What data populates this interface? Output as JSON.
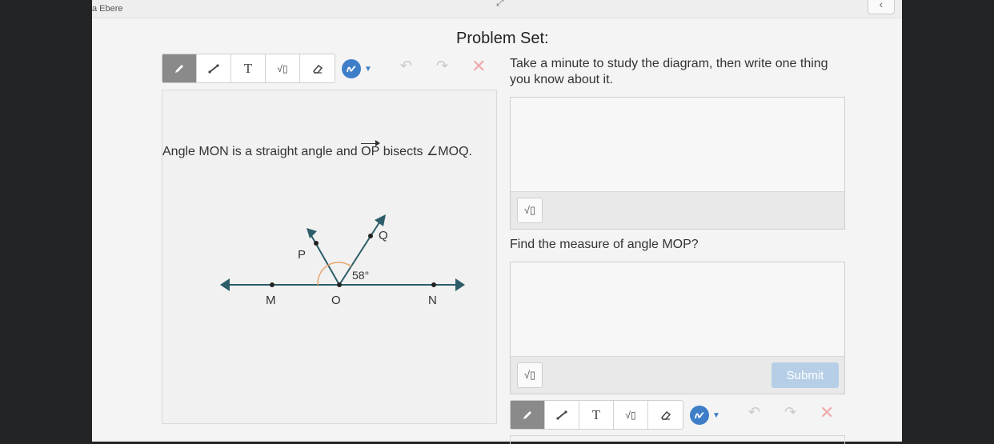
{
  "user": {
    "name": "a Ebere"
  },
  "header": {
    "title": "Problem Set:"
  },
  "toolbar": {
    "pencil": "pencil-icon",
    "line": "line-icon",
    "text_label": "T",
    "sqrt_label": "√▯",
    "eraser": "eraser-icon",
    "undo": "↶",
    "redo": "↷",
    "clear": "✕"
  },
  "problem": {
    "statement_pre": "Angle MON is a straight angle and ",
    "ray_label": "OP",
    "statement_post": " bisects ∠MOQ.",
    "diagram": {
      "points": [
        "M",
        "O",
        "N",
        "P",
        "Q"
      ],
      "angle_label": "58°"
    }
  },
  "questions": [
    {
      "prompt": "Take a minute to study the diagram, then write one thing you know about it.",
      "answer": ""
    },
    {
      "prompt": "Find the measure of angle MOP?",
      "answer": ""
    }
  ],
  "submit_label": "Submit",
  "colors": {
    "active_tool": "#8a8a8a",
    "accent": "#3e7ec9",
    "submit_disabled": "#b6cfe6",
    "diagram_line": "#2c5d69",
    "angle_arc": "#e8a66b"
  }
}
